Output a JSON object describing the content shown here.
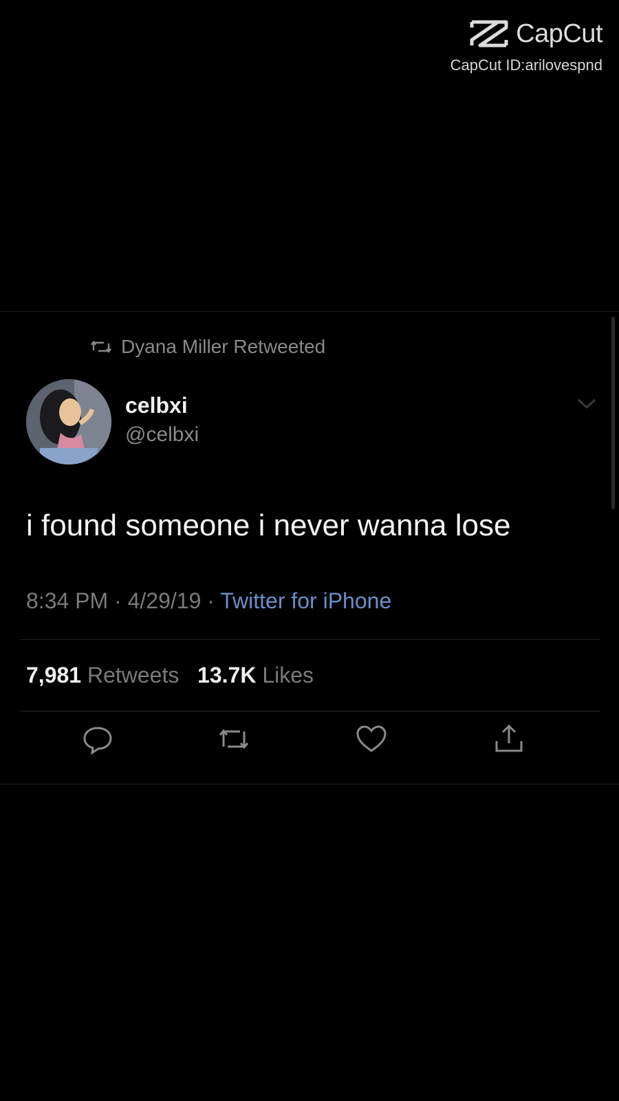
{
  "watermark": {
    "brand": "CapCut",
    "id_text": "CapCut ID:arilovespnd"
  },
  "tweet": {
    "retweet_label": "Dyana Miller Retweeted",
    "author": {
      "name": "celbxi",
      "handle": "@celbxi"
    },
    "text": "i found someone i never wanna lose",
    "time": "8:34 PM",
    "date": "4/29/19",
    "source": "Twitter for iPhone",
    "stats": {
      "retweets_count": "7,981",
      "retweets_label": "Retweets",
      "likes_count": "13.7K",
      "likes_label": "Likes"
    },
    "icons": [
      "retweet-icon",
      "chevron-down-icon",
      "reply-icon",
      "retweet-icon",
      "like-icon",
      "share-icon"
    ]
  },
  "colors": {
    "background": "#000000",
    "text": "#f4f4f4",
    "muted": "#7a7a7a",
    "link": "#6b8fc9"
  }
}
